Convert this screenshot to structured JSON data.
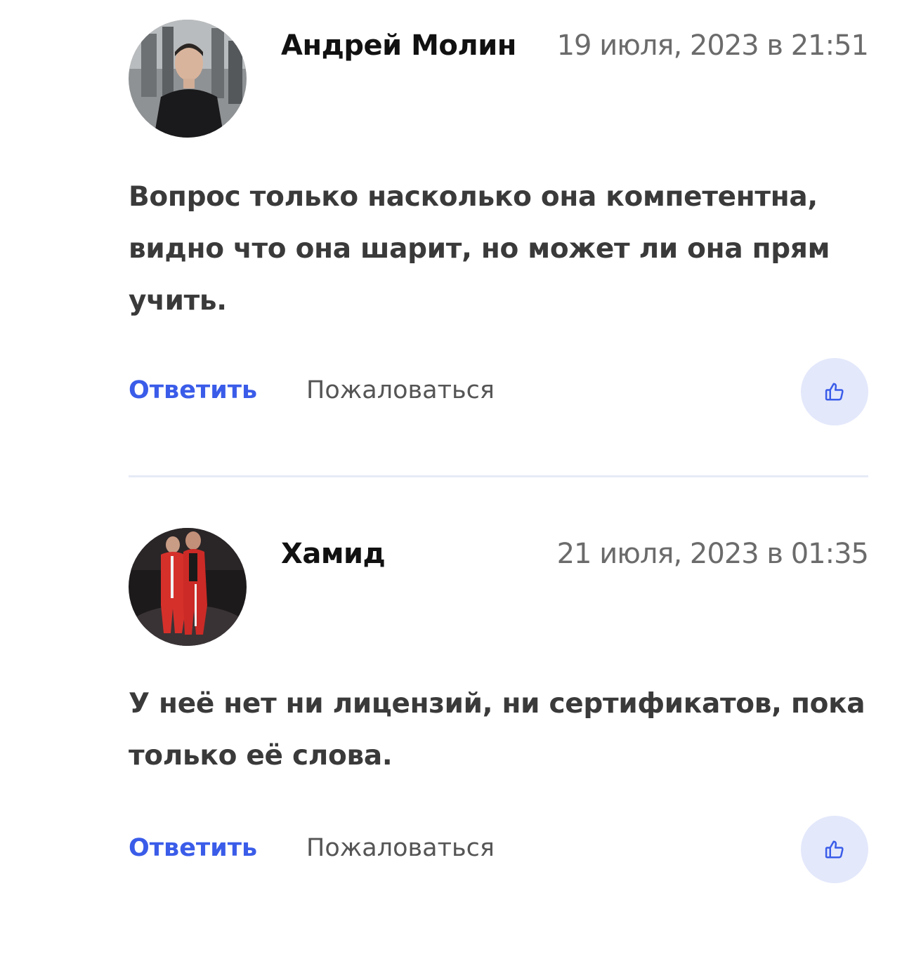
{
  "comments": [
    {
      "author": "Андрей Молин",
      "date": "19 июля, 2023 в 21:51",
      "text": "Вопрос только насколько она компетентна, видно что она шарит, но может ли она прям учить.",
      "reply_label": "Ответить",
      "report_label": "Пожаловаться",
      "like_icon": "thumbs-up-icon"
    },
    {
      "author": "Хамид",
      "date": "21 июля, 2023 в 01:35",
      "text": "У неё нет ни лицензий, ни сертификатов, пока только её слова.",
      "reply_label": "Ответить",
      "report_label": "Пожаловаться",
      "like_icon": "thumbs-up-icon"
    }
  ],
  "colors": {
    "accent": "#3a5ce9",
    "like_bg": "#e3e8fb",
    "divider": "#e6ebf7",
    "author": "#111111",
    "date": "#6b6b6b",
    "text": "#3a3a3a"
  }
}
